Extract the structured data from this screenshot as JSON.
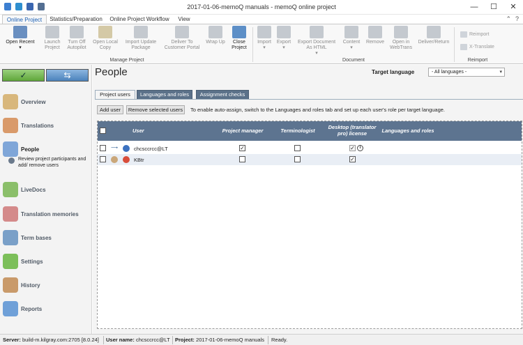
{
  "window": {
    "title": "2017-01-06-memoQ manuals - memoQ online project",
    "buttons": [
      "—",
      "☐",
      "✕"
    ]
  },
  "ribbon_tabs": [
    "Online Project",
    "Statistics/Preparation",
    "Online Project Workflow",
    "View"
  ],
  "ribbon": {
    "manage_project": {
      "label": "Manage Project",
      "buttons": [
        "Open Recent",
        "Launch Project",
        "Turn Off Autopilot",
        "Open Local Copy",
        "Import Update Package",
        "Deliver To Customer Portal",
        "Wrap Up",
        "Close Project"
      ]
    },
    "document": {
      "label": "Document",
      "buttons": [
        "Import",
        "Export",
        "Export Document As HTML",
        "Content",
        "Remove",
        "Open in WebTrans",
        "Deliver/Return"
      ]
    },
    "reimport": {
      "label": "Reimport",
      "buttons": [
        "Reimport",
        "X-Translate"
      ]
    }
  },
  "nav": {
    "items": [
      "Overview",
      "Translations",
      "People",
      "LiveDocs",
      "Translation memories",
      "Term bases",
      "Settings",
      "History",
      "Reports"
    ],
    "active": "People",
    "active_description": "Review project participants and add/ remove users",
    "top_buttons": [
      "✓",
      "⇆"
    ]
  },
  "main": {
    "title": "People",
    "target_language_label": "Target language",
    "target_language_value": "- All languages -",
    "subtabs": [
      "Project users",
      "Languages and roles",
      "Assignment checks"
    ],
    "add_user": "Add user",
    "remove_users": "Remove selected users",
    "hint": "To enable auto-assign, switch to the Languages and roles tab and set up each user's role per target language.",
    "columns": [
      "User",
      "Project manager",
      "Terminologist",
      "Desktop (translator pro) license",
      "Languages and roles"
    ],
    "rows": [
      {
        "user": "chcsccrcc@LT",
        "project_manager": true,
        "terminologist": false,
        "desktop_license": true,
        "license_disabled": true,
        "info": "i"
      },
      {
        "user": "KBtr",
        "project_manager": false,
        "terminologist": false,
        "desktop_license": true,
        "license_disabled": false
      }
    ]
  },
  "status": {
    "server_label": "Server:",
    "server_value": "build-m.kilgray.com:2705 [8.0.24]",
    "user_label": "User name:",
    "user_value": "chcsccrcc@LT",
    "project_label": "Project:",
    "project_value": "2017-01-06-memoQ manuals",
    "state": "Ready."
  },
  "colors": {
    "grid_header": "#5d7490",
    "subtab": "#5b7189",
    "accent_green": "#5fa63a"
  }
}
